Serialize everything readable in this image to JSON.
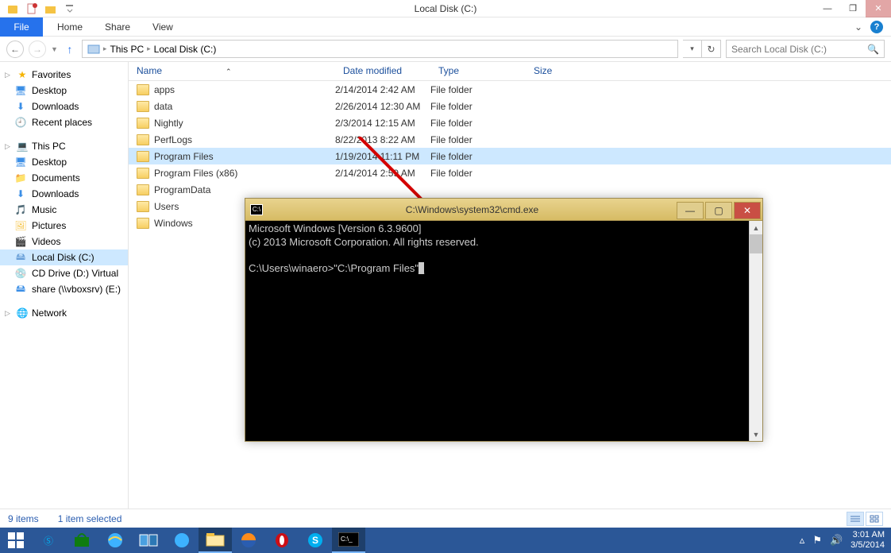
{
  "window": {
    "title": "Local Disk (C:)"
  },
  "ribbon": {
    "file": "File",
    "home": "Home",
    "share": "Share",
    "view": "View"
  },
  "breadcrumb": {
    "root": "This PC",
    "loc": "Local Disk (C:)"
  },
  "search": {
    "placeholder": "Search Local Disk (C:)"
  },
  "sidebar": {
    "favorites": "Favorites",
    "desktop": "Desktop",
    "downloads": "Downloads",
    "recent": "Recent places",
    "thispc": "This PC",
    "documents": "Documents",
    "music": "Music",
    "pictures": "Pictures",
    "videos": "Videos",
    "localdisk": "Local Disk (C:)",
    "cddrive": "CD Drive (D:) Virtual",
    "share": "share (\\\\vboxsrv) (E:)",
    "network": "Network"
  },
  "columns": {
    "name": "Name",
    "date": "Date modified",
    "type": "Type",
    "size": "Size"
  },
  "files": [
    {
      "name": "apps",
      "date": "2/14/2014 2:42 AM",
      "type": "File folder"
    },
    {
      "name": "data",
      "date": "2/26/2014 12:30 AM",
      "type": "File folder"
    },
    {
      "name": "Nightly",
      "date": "2/3/2014 12:15 AM",
      "type": "File folder"
    },
    {
      "name": "PerfLogs",
      "date": "8/22/2013 8:22 AM",
      "type": "File folder"
    },
    {
      "name": "Program Files",
      "date": "1/19/2014 11:11 PM",
      "type": "File folder",
      "selected": true
    },
    {
      "name": "Program Files (x86)",
      "date": "2/14/2014 2:59 AM",
      "type": "File folder"
    },
    {
      "name": "ProgramData",
      "date": "",
      "type": ""
    },
    {
      "name": "Users",
      "date": "",
      "type": ""
    },
    {
      "name": "Windows",
      "date": "",
      "type": ""
    }
  ],
  "status": {
    "items": "9 items",
    "selected": "1 item selected"
  },
  "cmd": {
    "title": "C:\\Windows\\system32\\cmd.exe",
    "line1": "Microsoft Windows [Version 6.3.9600]",
    "line2": "(c) 2013 Microsoft Corporation. All rights reserved.",
    "prompt": "C:\\Users\\winaero>\"C:\\Program Files\""
  },
  "clock": {
    "time": "3:01 AM",
    "date": "3/5/2014"
  }
}
